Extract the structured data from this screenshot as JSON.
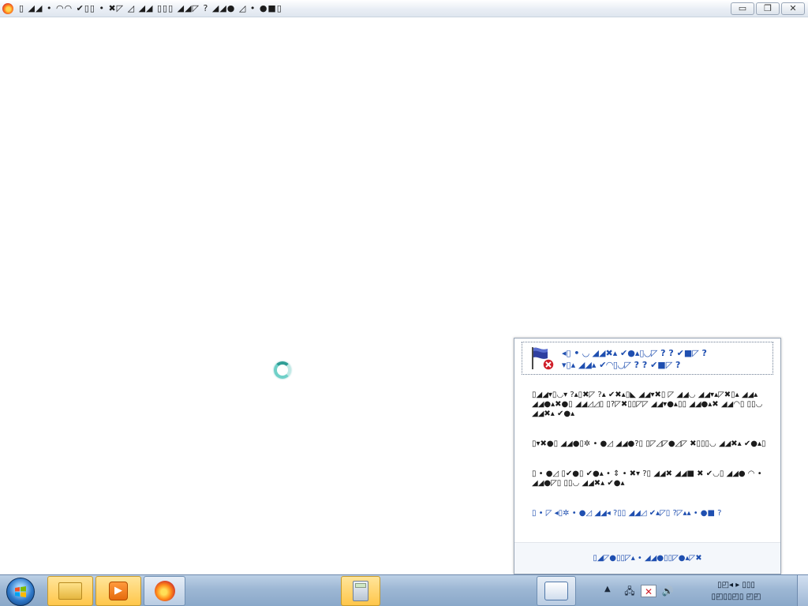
{
  "window": {
    "title": "▯ ◢◢ • ◠◠ ✔▯▯ • ✖◸ ◿ ◢◢ ▯▯▯ ◢◢◸ ? ◢◢● ◿ • ●■▯",
    "minimize_glyph": "▭",
    "maximize_glyph": "❐",
    "close_glyph": "✕"
  },
  "icons": {
    "app": "firefox-icon",
    "spinner": "loading-spinner-icon",
    "flag": "action-center-flag-error-icon",
    "start": "windows-start-icon"
  },
  "balloon": {
    "title_line1": "◂▯ • ◡ ◢◢✖▴ ✔●▴▯◡◸ ? ? ✔■◸ ?",
    "title_line2": "▾▯▴ ◢◢▴ ✔◠▯◡◸ ? ? ✔■◸ ?",
    "messages": [
      "▯◢◢▾▯◡▾ ?▴▯✖◸ ?▴ ✔✖▴▯◣ ◢◢▾✖▯ ◸ ◢◢◡ ◢◢▾▴◸✖▯▴ ◢◢▴ ◢◢●▴✖●▯ ◢◢◿◿▯ ▯?◸✖▯▯◸◸ ◢◢▾●▴▯▯ ◢◢●▴✖ ◢◢◠▯ ▯▯◡ ◢◢✖▴ ✔●▴",
      "▯▾✖●▯ ◢◢●▯✲ • ●◿ ◢◢●?▯ ▯◸◿◸●◿◸ ✖▯▯▯◡ ◢◢✖▴ ✔●▴▯",
      "▯ • ●◿ ▯✔●▯ ✔●▴ • ⇕ • ✖▾ ?▯ ◢◢✖ ◢◢■ ✖ ✔◡▯ ◢◢● ◠ • ◢◢●◸▯ ▯▯◡ ◢◢✖▴ ✔●▴",
      "▯ • ◸ ◂▯✲ • ●◿ ◢◢◂ ?▯▯ ◢◢◿ ✔▴◸▯ ?◸▴▴ • ●■ ?"
    ],
    "footer_link": "▯◢◸●▯▯◸▴ • ◢◢●▯▯◸●▴◸✖"
  },
  "taskbar": {
    "apps": [
      {
        "name": "windows-explorer",
        "active": true
      },
      {
        "name": "windows-media-player",
        "active": false
      },
      {
        "name": "firefox",
        "active": false
      },
      {
        "name": "calculator",
        "active": true
      },
      {
        "name": "network",
        "active": false
      }
    ],
    "tray_arrow": "▲",
    "tray_network": "🖧",
    "tray_flag": "✕",
    "tray_volume": "🔊",
    "clock_line1": "▯◰◂ ▸ ▯▯▯",
    "clock_line2": "▯◰▯▯◰▯ ◰◰"
  },
  "colors": {
    "link_blue": "#1f4fb0",
    "taskbar": "#9db7d4",
    "active_task": "#ffc64a",
    "error_red": "#d01f2a"
  }
}
